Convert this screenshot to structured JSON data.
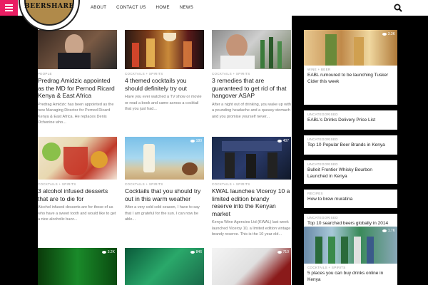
{
  "header": {
    "logo_text": "BEERSHARE",
    "nav": [
      "ABOUT",
      "CONTACT US",
      "HOME",
      "NEWS"
    ]
  },
  "colors": {
    "accent": "#e91e63"
  },
  "icons": {
    "menu": "hamburger-icon",
    "search": "search-icon",
    "views": "eye-icon"
  },
  "main": {
    "rows": [
      [
        {
          "category": "PEOPLE",
          "title": "Predrag Amidzic appointed as the MD for Pernod Ricard Kenya & East Africa",
          "excerpt": "Predrag Amidzic has been appointed as the new Managing Director for Pernod Ricard Kenya & East Africa. He replaces Denis Ochenine who...",
          "views": ""
        },
        {
          "category": "COCKTAILS + SPIRITS",
          "title": "4 themed cocktails you should definitely try out",
          "excerpt": "Have you ever watched a TV show or movie or read a book and came across a cocktail that you just had...",
          "views": ""
        },
        {
          "category": "COCKTAILS + SPIRITS",
          "title": "3 remedies that are guaranteed to get rid of that hangover ASAP",
          "excerpt": "After a night out of drinking, you wake up with a pounding headache and a queasy stomach and you promise yourself never...",
          "views": ""
        }
      ],
      [
        {
          "category": "COCKTAILS + SPIRITS",
          "title": "3 alcohol infused desserts that are to die for",
          "excerpt": "Alcohol infused desserts are for those of us who have a sweet tooth and would like to get a nice alcoholic buzz...",
          "views": ""
        },
        {
          "category": "COCKTAILS + SPIRITS",
          "title": "Cocktails that you should try out in this warm weather",
          "excerpt": "After a very cold cold season, I have to say that I am grateful for the sun. I can now be able...",
          "views": "180"
        },
        {
          "category": "COCKTAILS + SPIRITS",
          "title": "KWAL launches Viceroy 10 a limited edition brandy reserve into the Kenyan market",
          "excerpt": "Kenya Wine Agencies Ltd (KWAL) last week launched Viceroy 10, a limited edition vintage brandy reserve. This is the 10 year old...",
          "views": "407"
        }
      ],
      [
        {
          "category": "",
          "title": "",
          "excerpt": "",
          "views": "3.2K"
        },
        {
          "category": "",
          "title": "",
          "excerpt": "",
          "views": "846"
        },
        {
          "category": "",
          "title": "",
          "excerpt": "",
          "views": "710"
        }
      ]
    ]
  },
  "sidebar": {
    "items": [
      {
        "category": "WINE + BEER",
        "title": "EABL rumoured to be launching Tusker Cider this week",
        "views": "3.3K"
      },
      {
        "category": "UNCATEGORISED",
        "title": "EABL's Drinks Delivery Price List"
      },
      {
        "category": "UNCATEGORISED",
        "title": "Top 10 Popular Beer Brands in Kenya"
      },
      {
        "category": "UNCATEGORISED",
        "title": "Bulleit Frontier Whisky Bourbon Launched in Kenya"
      },
      {
        "category": "RECIPES",
        "title": "How to brew muratina"
      },
      {
        "category": "UNCATEGORISED",
        "title": "Top 10 searched beers globally in 2014"
      },
      {
        "category": "COCKTAILS + SPIRITS",
        "title": "5 places you can buy drinks online in Kenya",
        "views": "1.7K"
      }
    ]
  }
}
